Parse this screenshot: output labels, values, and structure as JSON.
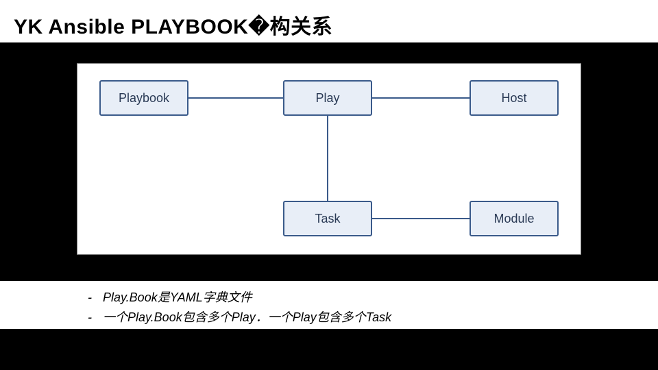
{
  "title": "YK Ansible PLAYBOOK�构关系",
  "diagram": {
    "nodes": {
      "playbook": "Playbook",
      "play": "Play",
      "host": "Host",
      "task": "Task",
      "module": "Module"
    },
    "edges": [
      {
        "from": "playbook",
        "to": "play"
      },
      {
        "from": "play",
        "to": "host"
      },
      {
        "from": "play",
        "to": "task"
      },
      {
        "from": "task",
        "to": "module"
      }
    ]
  },
  "notes": {
    "line1_prefix": "-",
    "line1": "Play.Book是YAML字典文件",
    "line2_prefix": "-",
    "line2": "一个Play.Book包含多个Play．一个Play包含多个Task"
  },
  "chart_data": {
    "type": "diagram",
    "title": "Ansible Playbook 结构关系",
    "nodes": [
      "Playbook",
      "Play",
      "Host",
      "Task",
      "Module"
    ],
    "edges": [
      [
        "Playbook",
        "Play"
      ],
      [
        "Play",
        "Host"
      ],
      [
        "Play",
        "Task"
      ],
      [
        "Task",
        "Module"
      ]
    ],
    "annotations": [
      "Play.Book是YAML字典文件",
      "一个Play.Book包含多个Play．一个Play包含多个Task"
    ]
  }
}
